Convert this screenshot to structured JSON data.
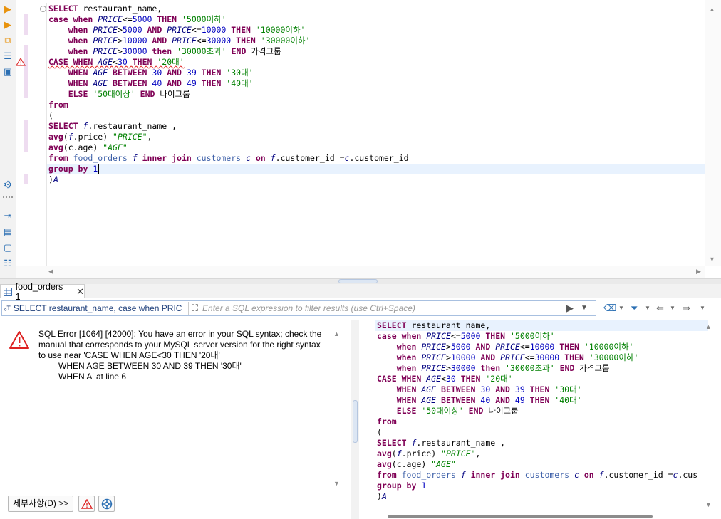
{
  "editor": {
    "lines": [
      [
        {
          "t": "SELECT",
          "c": "kw"
        },
        {
          "t": " restaurant_name,",
          "c": ""
        }
      ],
      [
        {
          "t": "case when ",
          "c": "kw"
        },
        {
          "t": "PRICE",
          "c": "id"
        },
        {
          "t": "<=",
          "c": ""
        },
        {
          "t": "5000",
          "c": "num"
        },
        {
          "t": " THEN ",
          "c": "kw"
        },
        {
          "t": "'5000이하'",
          "c": "str"
        }
      ],
      [
        {
          "t": "    when ",
          "c": "kw"
        },
        {
          "t": "PRICE",
          "c": "id"
        },
        {
          "t": ">",
          "c": ""
        },
        {
          "t": "5000",
          "c": "num"
        },
        {
          "t": " AND ",
          "c": "kw"
        },
        {
          "t": "PRICE",
          "c": "id"
        },
        {
          "t": "<=",
          "c": ""
        },
        {
          "t": "10000",
          "c": "num"
        },
        {
          "t": " THEN ",
          "c": "kw"
        },
        {
          "t": "'10000이하'",
          "c": "str"
        }
      ],
      [
        {
          "t": "    when ",
          "c": "kw"
        },
        {
          "t": "PRICE",
          "c": "id"
        },
        {
          "t": ">",
          "c": ""
        },
        {
          "t": "10000",
          "c": "num"
        },
        {
          "t": " AND ",
          "c": "kw"
        },
        {
          "t": "PRICE",
          "c": "id"
        },
        {
          "t": "<=",
          "c": ""
        },
        {
          "t": "30000",
          "c": "num"
        },
        {
          "t": " THEN ",
          "c": "kw"
        },
        {
          "t": "'30000이하'",
          "c": "str"
        }
      ],
      [
        {
          "t": "    when ",
          "c": "kw"
        },
        {
          "t": "PRICE",
          "c": "id"
        },
        {
          "t": ">",
          "c": ""
        },
        {
          "t": "30000",
          "c": "num"
        },
        {
          "t": " then ",
          "c": "kw"
        },
        {
          "t": "'30000초과'",
          "c": "str"
        },
        {
          "t": " END ",
          "c": "kw"
        },
        {
          "t": "가격그룹",
          "c": ""
        }
      ],
      [
        {
          "t": "CASE WHEN ",
          "c": "kw err"
        },
        {
          "t": "AGE",
          "c": "id err"
        },
        {
          "t": "<",
          "c": "err"
        },
        {
          "t": "30",
          "c": "num err"
        },
        {
          "t": " THEN ",
          "c": "kw err"
        },
        {
          "t": "'20대'",
          "c": "str err"
        }
      ],
      [
        {
          "t": "    WHEN ",
          "c": "kw"
        },
        {
          "t": "AGE",
          "c": "id"
        },
        {
          "t": " BETWEEN ",
          "c": "kw"
        },
        {
          "t": "30",
          "c": "num"
        },
        {
          "t": " AND ",
          "c": "kw"
        },
        {
          "t": "39",
          "c": "num"
        },
        {
          "t": " THEN ",
          "c": "kw"
        },
        {
          "t": "'30대'",
          "c": "str"
        }
      ],
      [
        {
          "t": "    WHEN ",
          "c": "kw"
        },
        {
          "t": "AGE",
          "c": "id"
        },
        {
          "t": " BETWEEN ",
          "c": "kw"
        },
        {
          "t": "40",
          "c": "num"
        },
        {
          "t": " AND ",
          "c": "kw"
        },
        {
          "t": "49",
          "c": "num"
        },
        {
          "t": " THEN ",
          "c": "kw"
        },
        {
          "t": "'40대'",
          "c": "str"
        }
      ],
      [
        {
          "t": "    ELSE ",
          "c": "kw"
        },
        {
          "t": "'50대이상'",
          "c": "str"
        },
        {
          "t": " END ",
          "c": "kw"
        },
        {
          "t": "나이그룹",
          "c": ""
        }
      ],
      [
        {
          "t": "from",
          "c": "kw"
        }
      ],
      [
        {
          "t": "(",
          "c": ""
        }
      ],
      [
        {
          "t": "SELECT ",
          "c": "kw"
        },
        {
          "t": "f",
          "c": "id"
        },
        {
          "t": ".restaurant_name ,",
          "c": ""
        }
      ],
      [
        {
          "t": "avg",
          "c": "kw"
        },
        {
          "t": "(",
          "c": ""
        },
        {
          "t": "f",
          "c": "id"
        },
        {
          "t": ".price) ",
          "c": ""
        },
        {
          "t": "\"PRICE\"",
          "c": "strq"
        },
        {
          "t": ",",
          "c": ""
        }
      ],
      [
        {
          "t": "avg",
          "c": "kw"
        },
        {
          "t": "(c.age) ",
          "c": ""
        },
        {
          "t": "\"AGE\"",
          "c": "strq"
        }
      ],
      [
        {
          "t": "from ",
          "c": "kw"
        },
        {
          "t": "food_orders ",
          "c": "tbl"
        },
        {
          "t": "f ",
          "c": "id"
        },
        {
          "t": "inner join ",
          "c": "kw"
        },
        {
          "t": "customers ",
          "c": "tbl"
        },
        {
          "t": "c ",
          "c": "id"
        },
        {
          "t": "on ",
          "c": "kw"
        },
        {
          "t": "f",
          "c": "id"
        },
        {
          "t": ".customer_id =",
          "c": ""
        },
        {
          "t": "c",
          "c": "id"
        },
        {
          "t": ".customer_id",
          "c": ""
        }
      ],
      [
        {
          "t": "group by ",
          "c": "kw"
        },
        {
          "t": "1",
          "c": "num"
        }
      ],
      [
        {
          "t": ")",
          "c": ""
        },
        {
          "t": "A",
          "c": "id"
        }
      ]
    ],
    "current_line": 15
  },
  "result_tab": {
    "label": "food_orders 1"
  },
  "filter": {
    "sql_preview": "SELECT restaurant_name, case when PRIC",
    "placeholder": "Enter a SQL expression to filter results (use Ctrl+Space)"
  },
  "error": {
    "line1": "SQL Error [1064] [42000]: You have an error in your SQL syntax; check the",
    "line2": "manual that corresponds to your MySQL server version for the right syntax",
    "line3": "to use near 'CASE WHEN AGE<30 THEN '20대'",
    "line4": "WHEN AGE BETWEEN 30 AND 39 THEN '30대'",
    "line5": "WHEN A' at line 6",
    "details_label": "세부사항(D) >>"
  },
  "query_panel": {
    "lines": [
      [
        {
          "t": "SELECT",
          "c": "kw"
        },
        {
          "t": " restaurant_name,",
          "c": ""
        }
      ],
      [
        {
          "t": "case when ",
          "c": "kw"
        },
        {
          "t": "PRICE",
          "c": "id"
        },
        {
          "t": "<=",
          "c": ""
        },
        {
          "t": "5000",
          "c": "num"
        },
        {
          "t": " THEN ",
          "c": "kw"
        },
        {
          "t": "'5000이하'",
          "c": "str"
        }
      ],
      [
        {
          "t": "    when ",
          "c": "kw"
        },
        {
          "t": "PRICE",
          "c": "id"
        },
        {
          "t": ">",
          "c": ""
        },
        {
          "t": "5000",
          "c": "num"
        },
        {
          "t": " AND ",
          "c": "kw"
        },
        {
          "t": "PRICE",
          "c": "id"
        },
        {
          "t": "<=",
          "c": ""
        },
        {
          "t": "10000",
          "c": "num"
        },
        {
          "t": " THEN ",
          "c": "kw"
        },
        {
          "t": "'10000이하'",
          "c": "str"
        }
      ],
      [
        {
          "t": "    when ",
          "c": "kw"
        },
        {
          "t": "PRICE",
          "c": "id"
        },
        {
          "t": ">",
          "c": ""
        },
        {
          "t": "10000",
          "c": "num"
        },
        {
          "t": " AND ",
          "c": "kw"
        },
        {
          "t": "PRICE",
          "c": "id"
        },
        {
          "t": "<=",
          "c": ""
        },
        {
          "t": "30000",
          "c": "num"
        },
        {
          "t": " THEN ",
          "c": "kw"
        },
        {
          "t": "'30000이하'",
          "c": "str"
        }
      ],
      [
        {
          "t": "    when ",
          "c": "kw"
        },
        {
          "t": "PRICE",
          "c": "id"
        },
        {
          "t": ">",
          "c": ""
        },
        {
          "t": "30000",
          "c": "num"
        },
        {
          "t": " then ",
          "c": "kw"
        },
        {
          "t": "'30000초과'",
          "c": "str"
        },
        {
          "t": " END ",
          "c": "kw"
        },
        {
          "t": "가격그룹",
          "c": ""
        }
      ],
      [
        {
          "t": "CASE WHEN ",
          "c": "kw"
        },
        {
          "t": "AGE",
          "c": "id"
        },
        {
          "t": "<",
          "c": ""
        },
        {
          "t": "30",
          "c": "num"
        },
        {
          "t": " THEN ",
          "c": "kw"
        },
        {
          "t": "'20대'",
          "c": "str"
        }
      ],
      [
        {
          "t": "    WHEN ",
          "c": "kw"
        },
        {
          "t": "AGE",
          "c": "id"
        },
        {
          "t": " BETWEEN ",
          "c": "kw"
        },
        {
          "t": "30",
          "c": "num"
        },
        {
          "t": " AND ",
          "c": "kw"
        },
        {
          "t": "39",
          "c": "num"
        },
        {
          "t": " THEN ",
          "c": "kw"
        },
        {
          "t": "'30대'",
          "c": "str"
        }
      ],
      [
        {
          "t": "    WHEN ",
          "c": "kw"
        },
        {
          "t": "AGE",
          "c": "id"
        },
        {
          "t": " BETWEEN ",
          "c": "kw"
        },
        {
          "t": "40",
          "c": "num"
        },
        {
          "t": " AND ",
          "c": "kw"
        },
        {
          "t": "49",
          "c": "num"
        },
        {
          "t": " THEN ",
          "c": "kw"
        },
        {
          "t": "'40대'",
          "c": "str"
        }
      ],
      [
        {
          "t": "    ELSE ",
          "c": "kw"
        },
        {
          "t": "'50대이상'",
          "c": "str"
        },
        {
          "t": " END ",
          "c": "kw"
        },
        {
          "t": "나이그룹",
          "c": ""
        }
      ],
      [
        {
          "t": "from",
          "c": "kw"
        }
      ],
      [
        {
          "t": "(",
          "c": ""
        }
      ],
      [
        {
          "t": "SELECT ",
          "c": "kw"
        },
        {
          "t": "f",
          "c": "id"
        },
        {
          "t": ".restaurant_name ,",
          "c": ""
        }
      ],
      [
        {
          "t": "avg",
          "c": "kw"
        },
        {
          "t": "(",
          "c": ""
        },
        {
          "t": "f",
          "c": "id"
        },
        {
          "t": ".price) ",
          "c": ""
        },
        {
          "t": "\"PRICE\"",
          "c": "strq"
        },
        {
          "t": ",",
          "c": ""
        }
      ],
      [
        {
          "t": "avg",
          "c": "kw"
        },
        {
          "t": "(c.age) ",
          "c": ""
        },
        {
          "t": "\"AGE\"",
          "c": "strq"
        }
      ],
      [
        {
          "t": "from ",
          "c": "kw"
        },
        {
          "t": "food_orders ",
          "c": "tbl"
        },
        {
          "t": "f ",
          "c": "id"
        },
        {
          "t": "inner join ",
          "c": "kw"
        },
        {
          "t": "customers ",
          "c": "tbl"
        },
        {
          "t": "c ",
          "c": "id"
        },
        {
          "t": "on ",
          "c": "kw"
        },
        {
          "t": "f",
          "c": "id"
        },
        {
          "t": ".customer_id =",
          "c": ""
        },
        {
          "t": "c",
          "c": "id"
        },
        {
          "t": ".cus",
          "c": ""
        }
      ],
      [
        {
          "t": "group by ",
          "c": "kw"
        },
        {
          "t": "1",
          "c": "num"
        }
      ],
      [
        {
          "t": ")",
          "c": ""
        },
        {
          "t": "A",
          "c": "id"
        }
      ]
    ],
    "current_line": 0
  },
  "colors": {
    "keyword": "#7f0055",
    "identifier": "#000080",
    "number": "#0000c0",
    "string": "#008000",
    "error": "#e03030",
    "selection": "#e8f2fe"
  }
}
